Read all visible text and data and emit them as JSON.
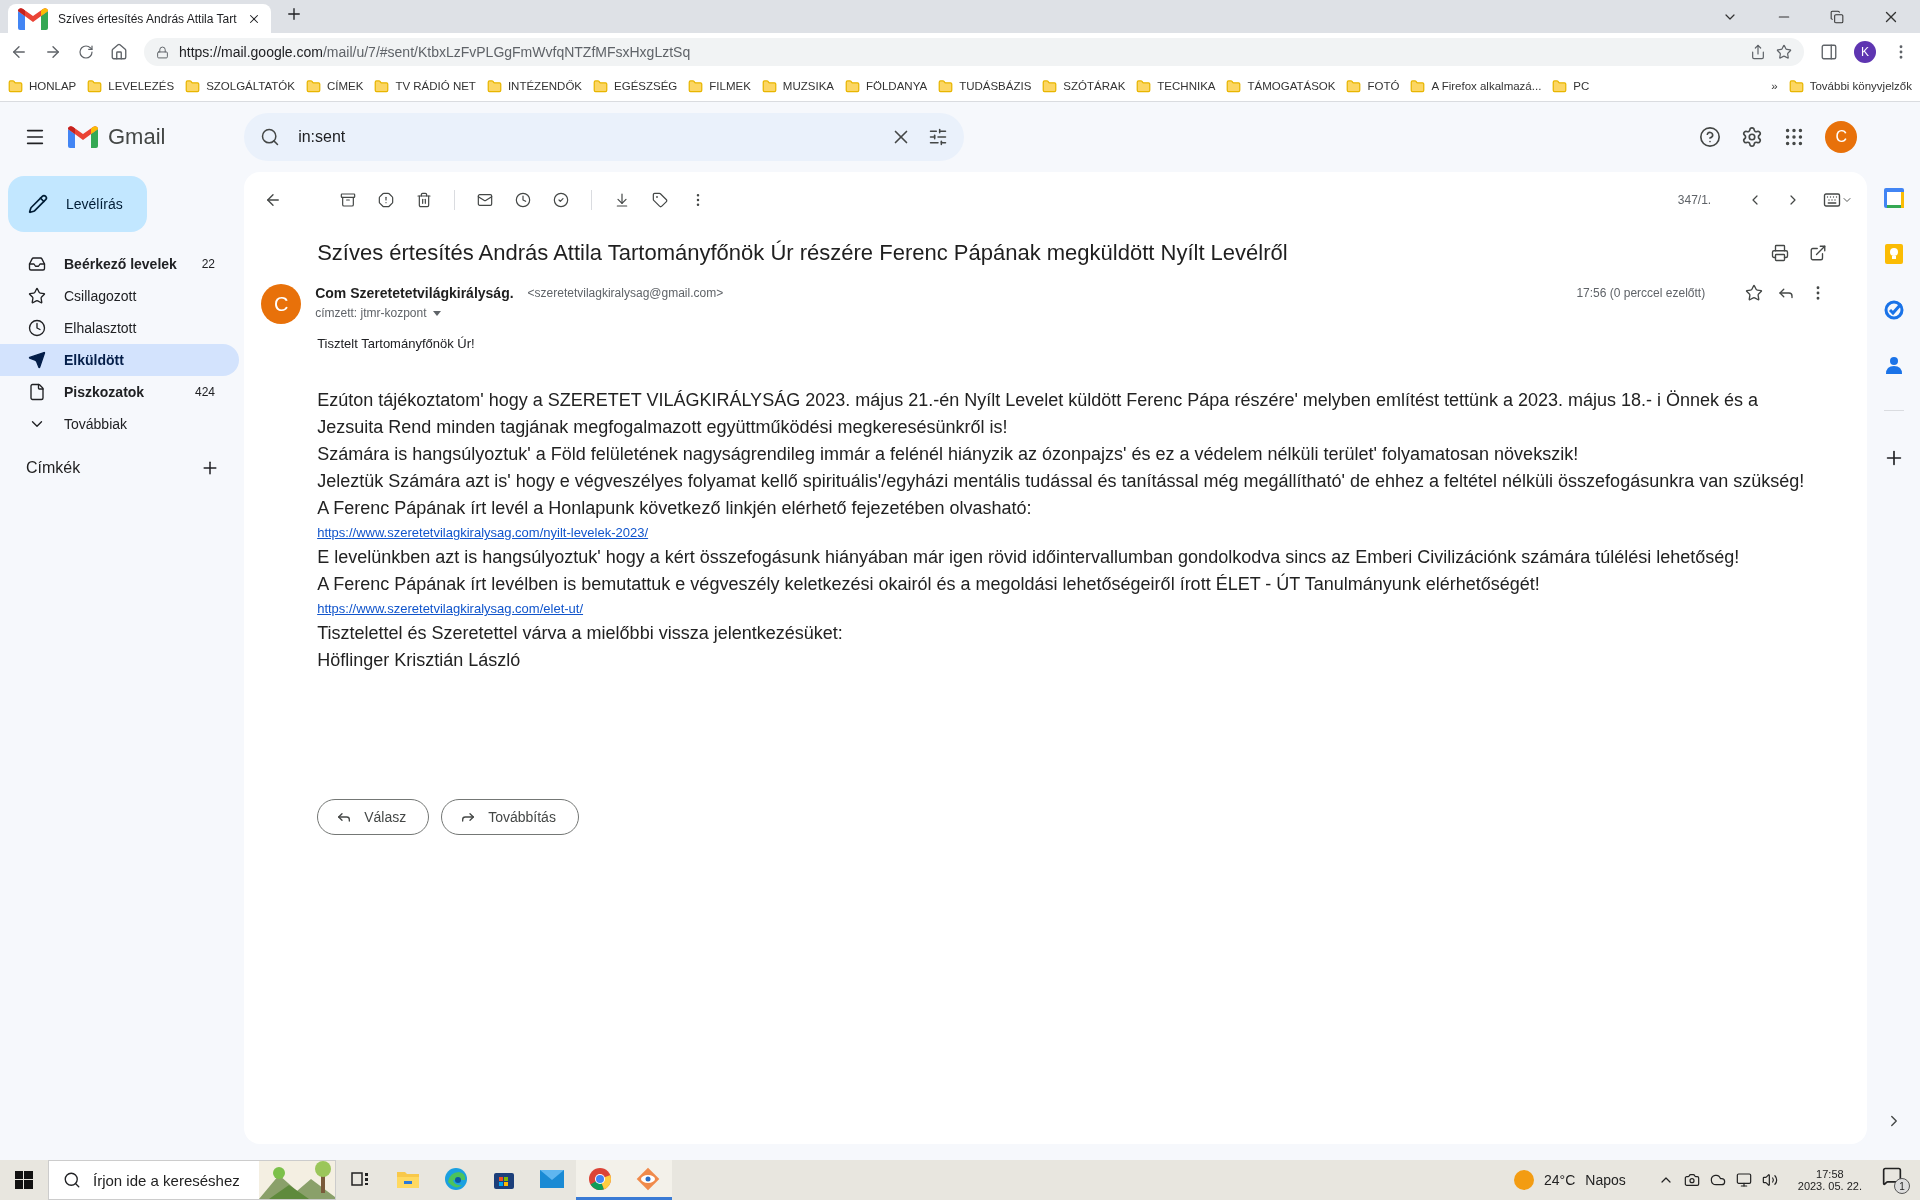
{
  "browser": {
    "tab_title": "Szíves értesítés András Attila Tart",
    "url_host": "https://mail.google.com",
    "url_path": "/mail/u/7/#sent/KtbxLzFvPLGgFmWvfqNTZfMFsxHxgLztSq",
    "profile": "K",
    "bookmarks": [
      "HONLAP",
      "LEVELEZÉS",
      "SZOLGÁLTATÓK",
      "CÍMEK",
      "TV RÁDIÓ NET",
      "INTÉZENDŐK",
      "EGÉSZSÉG",
      "FILMEK",
      "MUZSIKA",
      "FÖLDANYA",
      "TUDÁSBÁZIS",
      "SZÓTÁRAK",
      "TECHNIKA",
      "TÁMOGATÁSOK",
      "FOTÓ",
      "A Firefox alkalmazá...",
      "PC"
    ],
    "more_bookmarks": "»",
    "other_bookmarks": "További könyvjelzők"
  },
  "gmail": {
    "brand": "Gmail",
    "search": {
      "value": "in:sent"
    },
    "avatar": "C",
    "compose": "Levélírás",
    "nav": [
      {
        "kind": "inbox",
        "label": "Beérkező levelek",
        "count": "22",
        "unread": true,
        "selected": false
      },
      {
        "kind": "starred",
        "label": "Csillagozott",
        "unread": false,
        "selected": false
      },
      {
        "kind": "snoozed",
        "label": "Elhalasztott",
        "unread": false,
        "selected": false
      },
      {
        "kind": "sent",
        "label": "Elküldött",
        "unread": true,
        "selected": true
      },
      {
        "kind": "drafts",
        "label": "Piszkozatok",
        "count": "424",
        "unread": true,
        "selected": false
      },
      {
        "kind": "more",
        "label": "Továbbiak",
        "unread": false,
        "selected": false
      }
    ],
    "labels_heading": "Címkék"
  },
  "toolbar": {
    "counter": "347/1."
  },
  "message": {
    "subject": "Szíves értesítés András Attila Tartományfőnök Úr részére Ferenc Pápának megküldött Nyílt Levélről",
    "avatar": "C",
    "sender_name": "Com Szeretetetvilágkirályság.",
    "sender_email": "<szeretetvilagkiralysag@gmail.com>",
    "recipient": "címzett: jtmr-kozpont",
    "time": "17:56 (0 perccel ezelőtt)",
    "body": [
      {
        "kind": "greeting",
        "text": "Tisztelt Tartományfőnök Úr!"
      },
      {
        "kind": "line",
        "text": "Ezúton tájékoztatom' hogy a SZERETET VILÁGKIRÁLYSÁG 2023. május 21.-én Nyílt Levelet küldött Ferenc Pápa részére' melyben említést tettünk a 2023. május 18.- i Önnek és a Jezsuita Rend minden tagjának megfogalmazott együttműködési megkeresésünkről is!"
      },
      {
        "kind": "line",
        "text": "Számára is hangsúlyoztuk' a Föld felületének nagyságrendileg immár a felénél hiányzik az ózonpajzs' és ez a védelem nélküli terület' folyamatosan növekszik!"
      },
      {
        "kind": "line",
        "text": "Jeleztük Számára azt is' hogy e végveszélyes folyamat kellő spirituális'/egyházi mentális tudással és tanítással még megállítható' de ehhez a feltétel nélküli összefogásunkra van szükség!"
      },
      {
        "kind": "line",
        "text": "A Ferenc Pápának írt levél a Honlapunk következő linkjén elérhető fejezetében olvasható:"
      },
      {
        "kind": "link",
        "text": "https://www.szeretetvilagkiralysag.com/nyilt-levelek-2023/"
      },
      {
        "kind": "line",
        "text": "E levelünkben azt is hangsúlyoztuk' hogy a kért összefogásunk hiányában már igen rövid időintervallumban gondolkodva sincs az Emberi Civilizációnk számára túlélési lehetőség!"
      },
      {
        "kind": "line",
        "text": "A Ferenc Pápának írt levélben is bemutattuk e végveszély keletkezési okairól és a megoldási lehetőségeiről írott ÉLET - ÚT Tanulmányunk elérhetőségét!"
      },
      {
        "kind": "link",
        "text": "https://www.szeretetvilagkiralysag.com/elet-ut/"
      },
      {
        "kind": "line",
        "text": "Tisztelettel és Szeretettel várva a mielőbbi vissza jelentkezésüket:"
      },
      {
        "kind": "line",
        "text": "Höflinger Krisztián László"
      }
    ],
    "actions": [
      {
        "kind": "reply",
        "label": "Válasz"
      },
      {
        "kind": "forward",
        "label": "Továbbítás"
      }
    ]
  },
  "taskbar": {
    "search": {
      "placeholder": "Írjon ide a kereséshez"
    },
    "apps": [
      {
        "kind": "taskview",
        "running": false
      },
      {
        "kind": "explorer",
        "running": false
      },
      {
        "kind": "edge",
        "running": false
      },
      {
        "kind": "store",
        "running": false
      },
      {
        "kind": "mail",
        "running": false
      },
      {
        "kind": "chrome",
        "running": true
      },
      {
        "kind": "viewer",
        "running": true
      }
    ],
    "temperature": "24°C",
    "weather": "Napos",
    "time": "17:58",
    "date": "2023. 05. 22.",
    "notifications": "1"
  }
}
